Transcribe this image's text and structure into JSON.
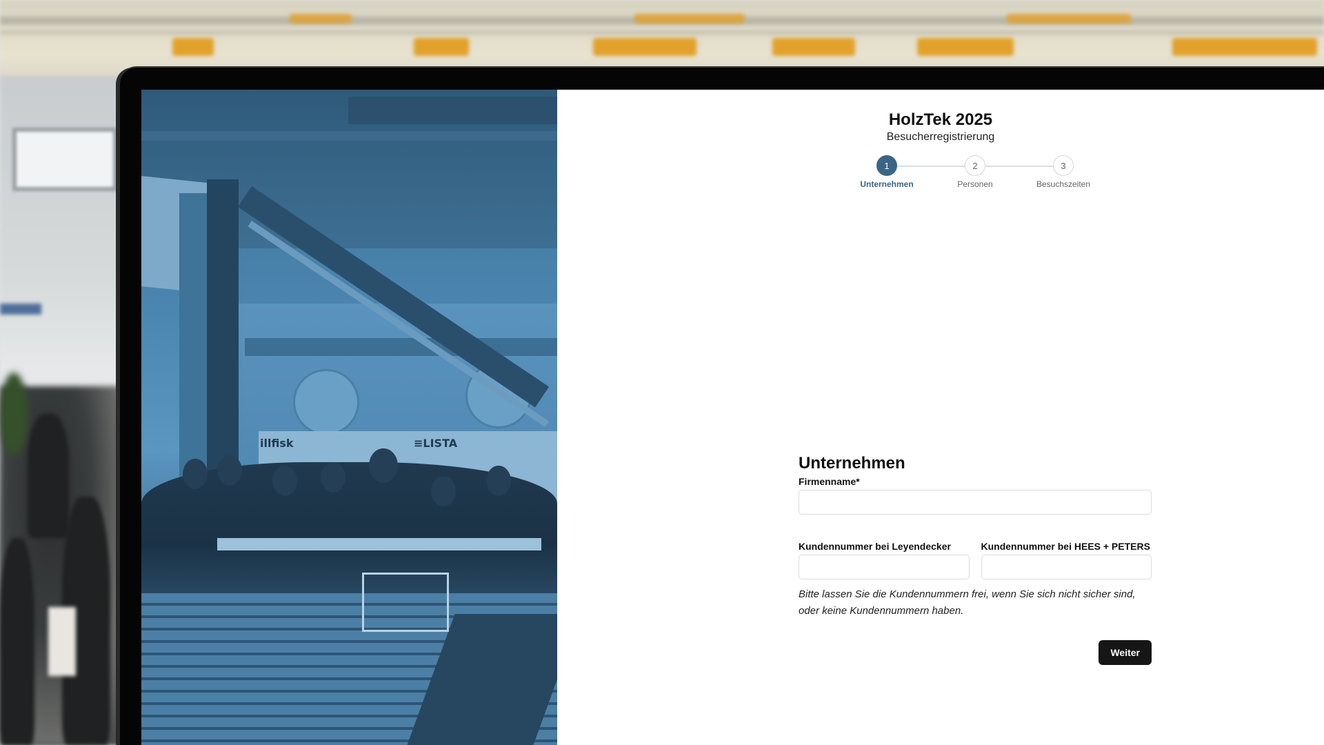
{
  "app": {
    "title": "HolzTek 2025",
    "subtitle": "Besucherregistrierung"
  },
  "stepper": {
    "active_color": "#3b6586",
    "steps": [
      {
        "number": "1",
        "label": "Unternehmen",
        "state": "active"
      },
      {
        "number": "2",
        "label": "Personen",
        "state": "inactive"
      },
      {
        "number": "3",
        "label": "Besuchszeiten",
        "state": "inactive"
      }
    ]
  },
  "photo_panel": {
    "booth_signs": [
      "illfisk",
      "≡LISTA"
    ]
  },
  "form": {
    "section_title": "Unternehmen",
    "company_name": {
      "label": "Firmenname*",
      "value": "",
      "placeholder": ""
    },
    "customer_no_leyendecker": {
      "label": "Kundennummer bei Leyendecker",
      "value": "",
      "placeholder": ""
    },
    "customer_no_hees_peters": {
      "label": "Kundennummer bei HEES + PETERS",
      "value": "",
      "placeholder": ""
    },
    "hint_line1": "Bitte lassen Sie die Kundennummern frei, wenn Sie sich nicht sicher sind,",
    "hint_line2": "oder keine Kundennummern haben.",
    "next_button": "Weiter"
  }
}
